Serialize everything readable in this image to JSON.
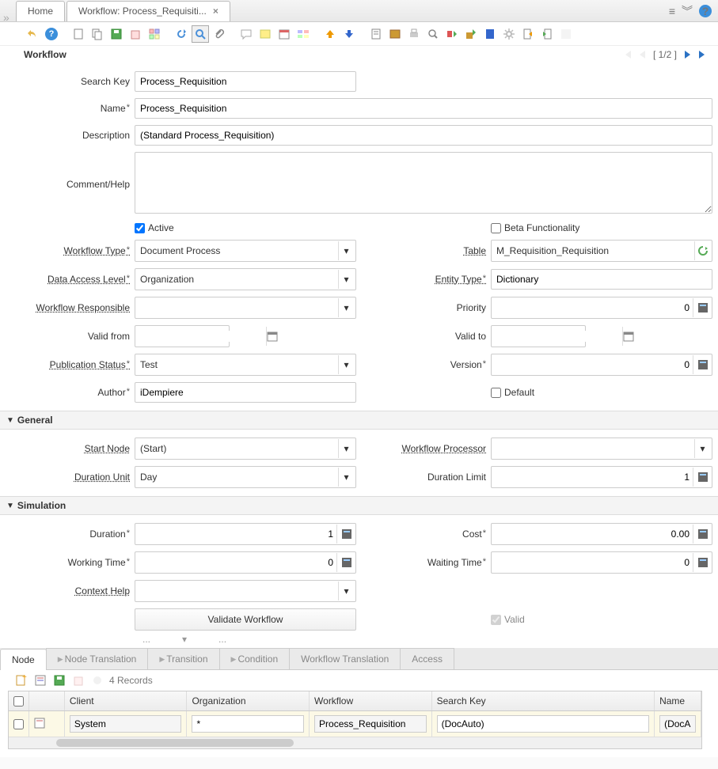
{
  "tabs": {
    "home": "Home",
    "workflow": "Workflow: Process_Requisiti..."
  },
  "header": {
    "title": "Workflow",
    "pager": "[ 1/2 ]"
  },
  "labels": {
    "searchKey": "Search Key",
    "name": "Name",
    "description": "Description",
    "commentHelp": "Comment/Help",
    "active": "Active",
    "beta": "Beta Functionality",
    "workflowType": "Workflow Type",
    "table": "Table",
    "dataAccess": "Data Access Level",
    "entityType": "Entity Type",
    "workflowResponsible": "Workflow Responsible",
    "priority": "Priority",
    "validFrom": "Valid from",
    "validTo": "Valid to",
    "pubStatus": "Publication Status",
    "version": "Version",
    "author": "Author",
    "default": "Default",
    "general": "General",
    "startNode": "Start Node",
    "workflowProcessor": "Workflow Processor",
    "durationUnit": "Duration Unit",
    "durationLimit": "Duration Limit",
    "simulation": "Simulation",
    "duration": "Duration",
    "cost": "Cost",
    "workingTime": "Working Time",
    "waitingTime": "Waiting Time",
    "contextHelp": "Context Help",
    "validateWorkflow": "Validate Workflow",
    "valid": "Valid"
  },
  "values": {
    "searchKey": "Process_Requisition",
    "name": "Process_Requisition",
    "description": "(Standard Process_Requisition)",
    "commentHelp": "",
    "workflowType": "Document Process",
    "table": "M_Requisition_Requisition",
    "dataAccess": "Organization",
    "entityType": "Dictionary",
    "priority": "0",
    "pubStatus": "Test",
    "version": "0",
    "author": "iDempiere",
    "startNode": "(Start)",
    "durationUnit": "Day",
    "durationLimit": "1",
    "duration": "1",
    "cost": "0.00",
    "workingTime": "0",
    "waitingTime": "0"
  },
  "subtabs": {
    "node": "Node",
    "nodeTranslation": "Node Translation",
    "transition": "Transition",
    "condition": "Condition",
    "workflowTranslation": "Workflow Translation",
    "access": "Access"
  },
  "subToolbar": {
    "records": "4 Records"
  },
  "gridHeaders": {
    "client": "Client",
    "org": "Organization",
    "workflow": "Workflow",
    "searchKey": "Search Key",
    "name": "Name"
  },
  "gridRow": {
    "client": "System",
    "org": "*",
    "workflow": "Process_Requisition",
    "searchKey": "(DocAuto)",
    "name": "(DocAu"
  },
  "miniToolbar": {
    "dots1": "...",
    "dots2": "..."
  }
}
